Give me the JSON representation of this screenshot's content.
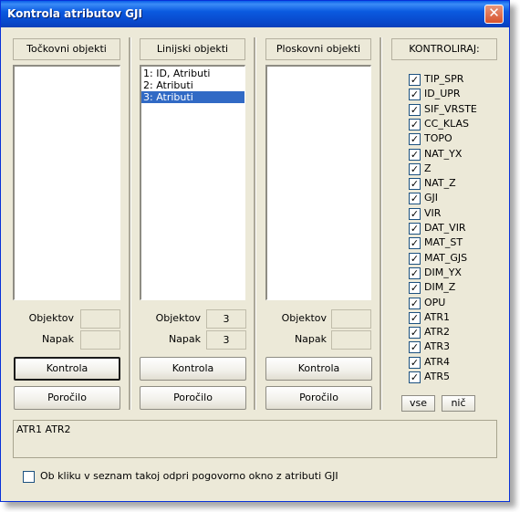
{
  "window": {
    "title": "Kontrola atributov GJI",
    "close_glyph": "✕"
  },
  "columns": [
    {
      "header": "Točkovni objekti",
      "items": [],
      "objektov_label": "Objektov",
      "objektov_value": "",
      "napak_label": "Napak",
      "napak_value": "",
      "kontrola": "Kontrola",
      "porocilo": "Poročilo"
    },
    {
      "header": "Linijski objekti",
      "items": [
        "1: ID,  Atributi",
        "2: Atributi",
        "3: Atributi"
      ],
      "selected_index": 2,
      "objektov_label": "Objektov",
      "objektov_value": "3",
      "napak_label": "Napak",
      "napak_value": "3",
      "kontrola": "Kontrola",
      "porocilo": "Poročilo"
    },
    {
      "header": "Ploskovni objekti",
      "items": [],
      "objektov_label": "Objektov",
      "objektov_value": "",
      "napak_label": "Napak",
      "napak_value": "",
      "kontrola": "Kontrola",
      "porocilo": "Poročilo"
    }
  ],
  "kontroliraj": {
    "header": "KONTROLIRAJ:",
    "check_glyph": "✓",
    "items": [
      "TIP_SPR",
      "ID_UPR",
      "SIF_VRSTE",
      "CC_KLAS",
      "TOPO",
      "NAT_YX",
      "Z",
      "NAT_Z",
      "GJI",
      "VIR",
      "DAT_VIR",
      "MAT_ST",
      "MAT_GJS",
      "DIM_YX",
      "DIM_Z",
      "OPU",
      "ATR1",
      "ATR2",
      "ATR3",
      "ATR4",
      "ATR5"
    ],
    "vse": "vse",
    "nic": "nič"
  },
  "result_text": "ATR1  ATR2",
  "bottom_checkbox": {
    "label": "Ob kliku v seznam takoj odpri pogovorno okno z atributi GJI",
    "checked": false
  }
}
